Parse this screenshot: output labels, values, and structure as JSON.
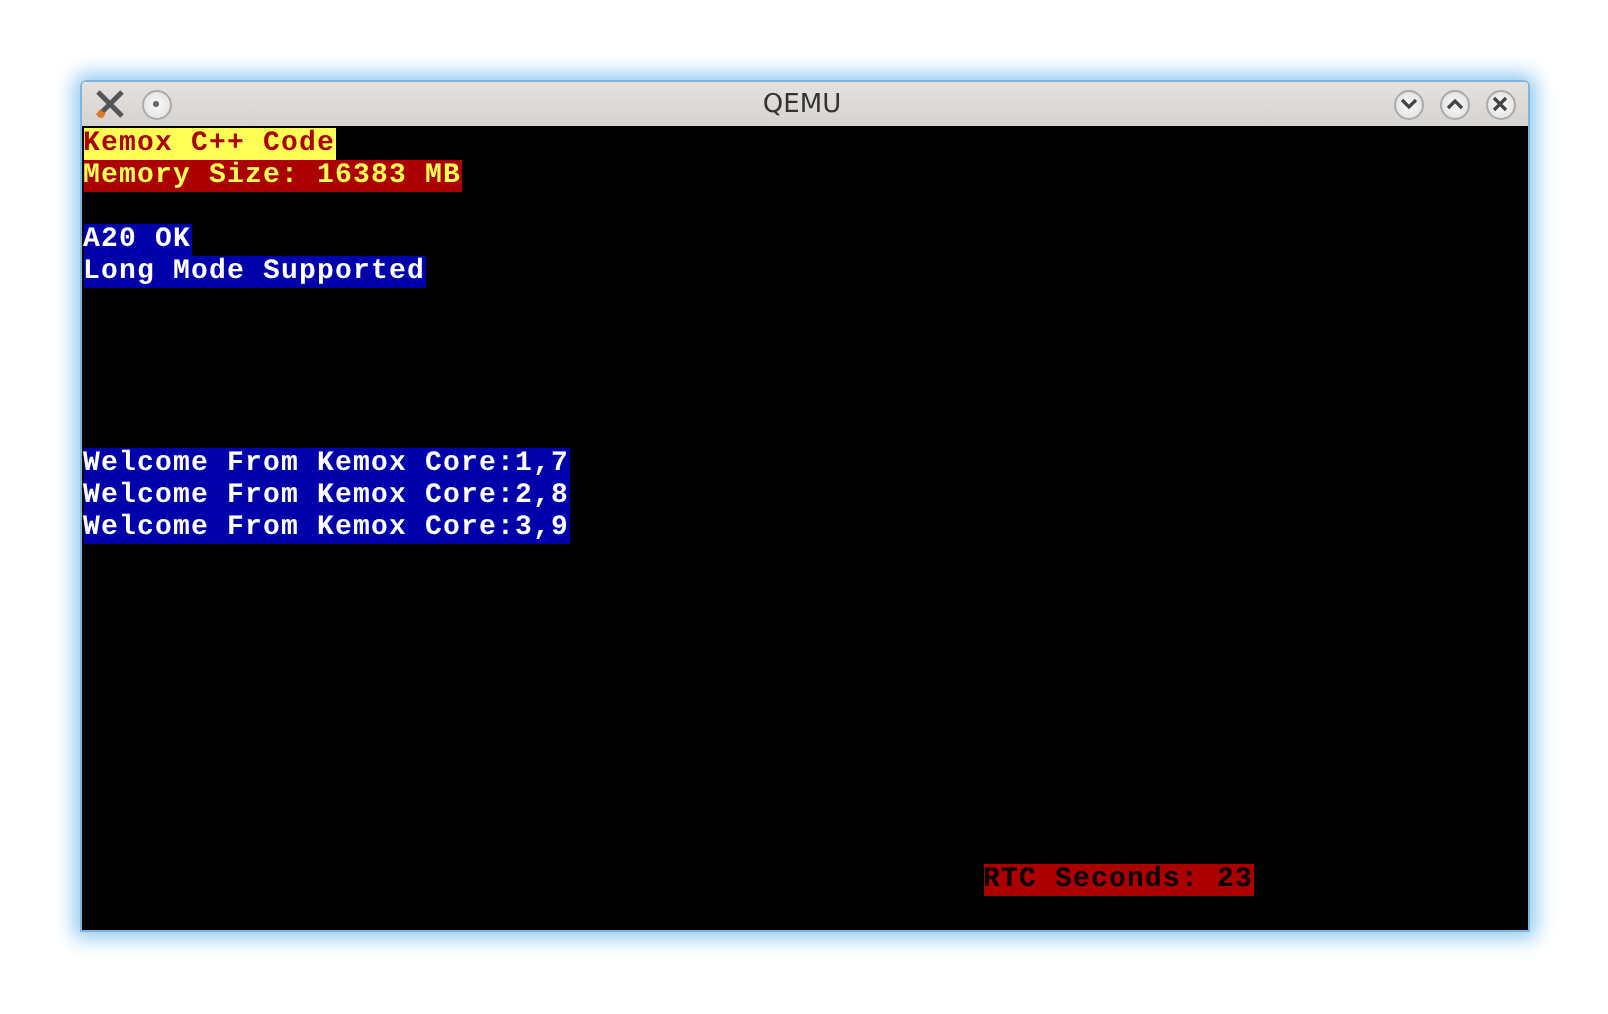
{
  "window": {
    "title": "QEMU"
  },
  "rows": [
    {
      "kind": "banner",
      "text": "Kemox C++ Code"
    },
    {
      "kind": "alert",
      "text": "Memory Size: 16383 MB"
    },
    {
      "kind": "blank"
    },
    {
      "kind": "info",
      "text": "A20 OK"
    },
    {
      "kind": "info",
      "text": "Long Mode Supported"
    },
    {
      "kind": "blank"
    },
    {
      "kind": "blank"
    },
    {
      "kind": "blank"
    },
    {
      "kind": "blank"
    },
    {
      "kind": "blank"
    },
    {
      "kind": "info",
      "text": "Welcome From Kemox Core:1,7"
    },
    {
      "kind": "info",
      "text": "Welcome From Kemox Core:2,8"
    },
    {
      "kind": "info",
      "text": "Welcome From Kemox Core:3,9"
    },
    {
      "kind": "blank"
    },
    {
      "kind": "blank"
    },
    {
      "kind": "blank"
    },
    {
      "kind": "blank"
    },
    {
      "kind": "blank"
    },
    {
      "kind": "blank"
    },
    {
      "kind": "blank"
    },
    {
      "kind": "blank"
    },
    {
      "kind": "blank"
    },
    {
      "kind": "blank"
    },
    {
      "kind": "status",
      "text": "RTC Seconds: 23"
    },
    {
      "kind": "blank"
    }
  ]
}
